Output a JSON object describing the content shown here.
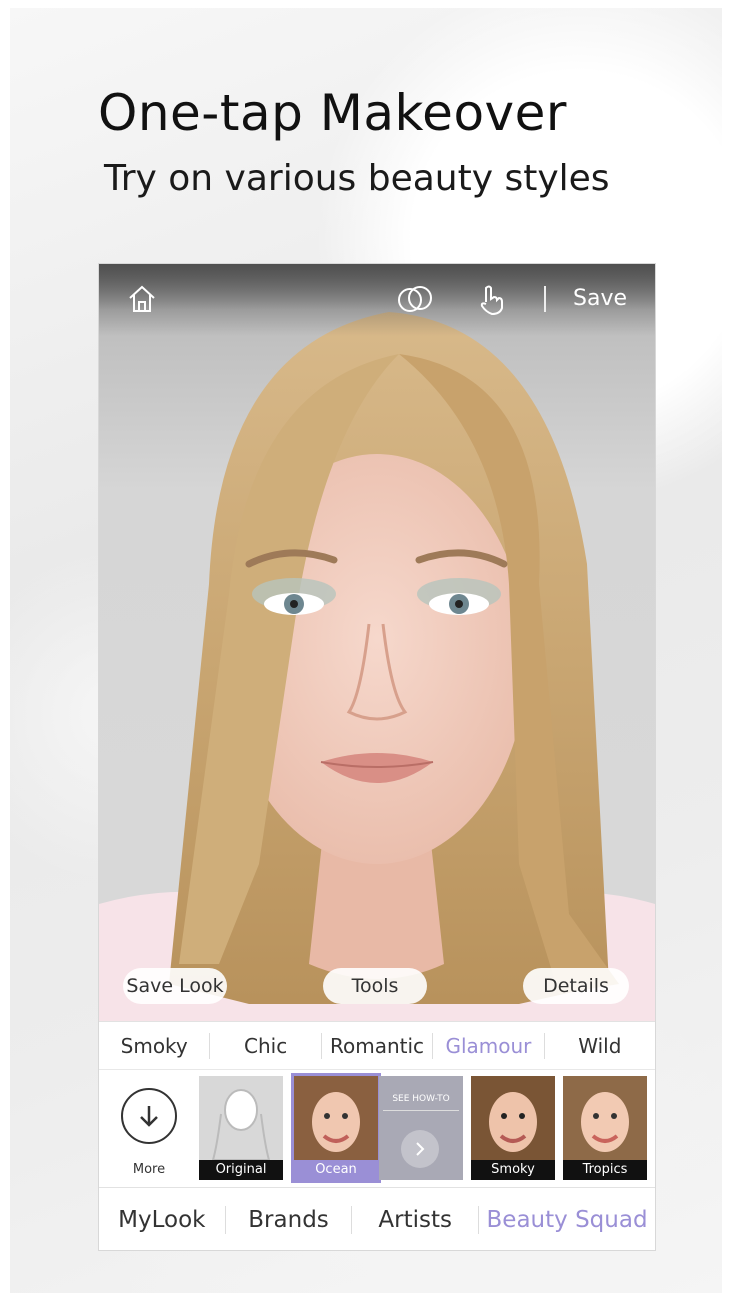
{
  "promo": {
    "title": "One-tap Makeover",
    "subtitle": "Try on various beauty styles"
  },
  "topbar": {
    "icons": [
      "home-icon",
      "compare-icon",
      "touch-icon"
    ],
    "save_label": "Save"
  },
  "photo_actions": {
    "save_look": "Save Look",
    "tools": "Tools",
    "details": "Details"
  },
  "style_tabs": [
    {
      "label": "Smoky",
      "active": false
    },
    {
      "label": "Chic",
      "active": false
    },
    {
      "label": "Romantic",
      "active": false
    },
    {
      "label": "Glamour",
      "active": true
    },
    {
      "label": "Wild",
      "active": false
    }
  ],
  "looks": {
    "more_label": "More",
    "items": [
      {
        "label": "Original",
        "selected": false
      },
      {
        "label": "Ocean",
        "selected": true
      },
      {
        "label": "SEE HOW-TO",
        "selected": false
      },
      {
        "label": "Smoky",
        "selected": false
      },
      {
        "label": "Tropics",
        "selected": false
      }
    ]
  },
  "bottom_nav": [
    {
      "label": "MyLook",
      "active": false
    },
    {
      "label": "Brands",
      "active": false
    },
    {
      "label": "Artists",
      "active": false
    },
    {
      "label": "Beauty Squad",
      "active": true
    }
  ],
  "colors": {
    "accent": "#9a8fd6"
  }
}
